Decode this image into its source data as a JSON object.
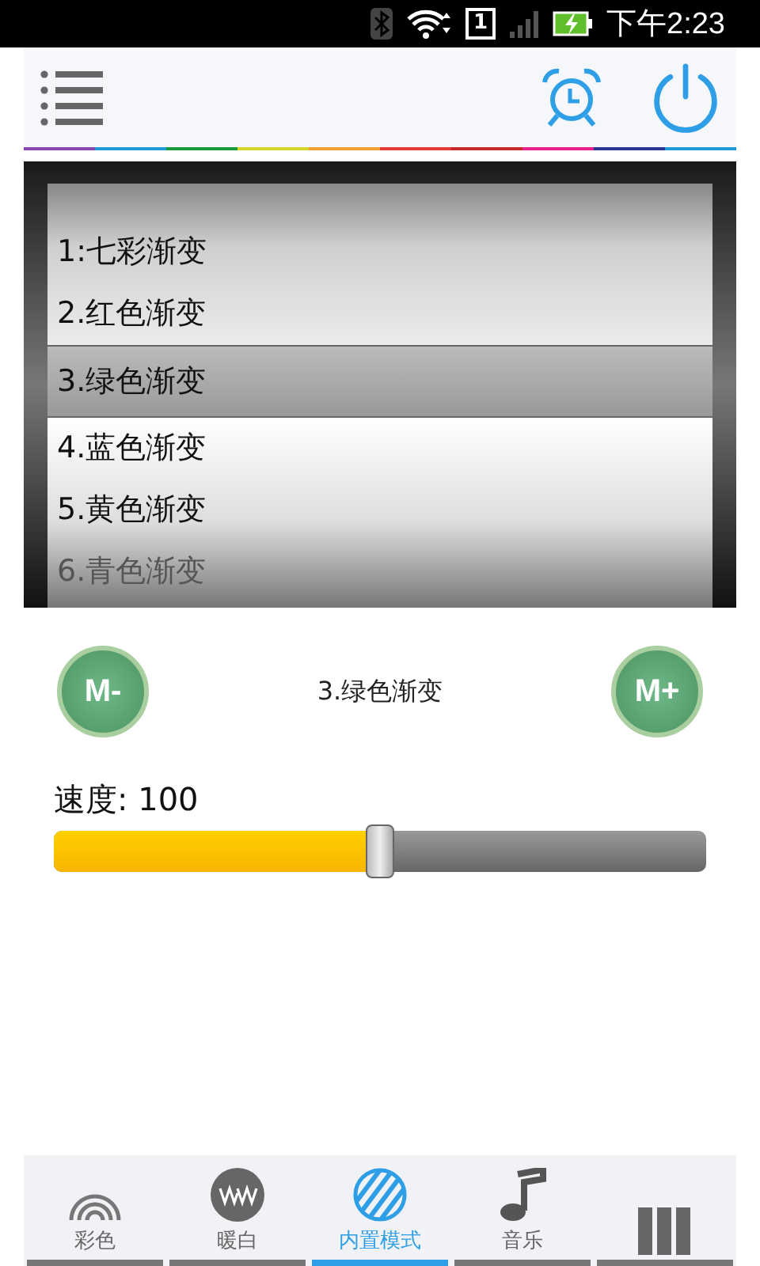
{
  "status_bar": {
    "time": "下午2:23",
    "sim_slot": "1"
  },
  "picker": {
    "items": [
      {
        "label": "1:七彩渐变",
        "selected": false
      },
      {
        "label": "2.红色渐变",
        "selected": false
      },
      {
        "label": "3.绿色渐变",
        "selected": true
      },
      {
        "label": "4.蓝色渐变",
        "selected": false
      },
      {
        "label": "5.黄色渐变",
        "selected": false
      },
      {
        "label": "6.青色渐变",
        "selected": false
      }
    ]
  },
  "mode_controls": {
    "prev_button": "M-",
    "current_mode": "3.绿色渐变",
    "next_button": "M+"
  },
  "speed": {
    "label": "速度: 100",
    "level": 0.5
  },
  "bottom_nav": [
    {
      "kind": "rainbow",
      "label": "彩色",
      "selected": false
    },
    {
      "kind": "warm",
      "label": "暖白",
      "selected": false
    },
    {
      "kind": "stripes",
      "label": "内置模式",
      "selected": true
    },
    {
      "kind": "music",
      "label": "音乐",
      "selected": false
    },
    {
      "kind": "grid",
      "selected": false
    }
  ]
}
